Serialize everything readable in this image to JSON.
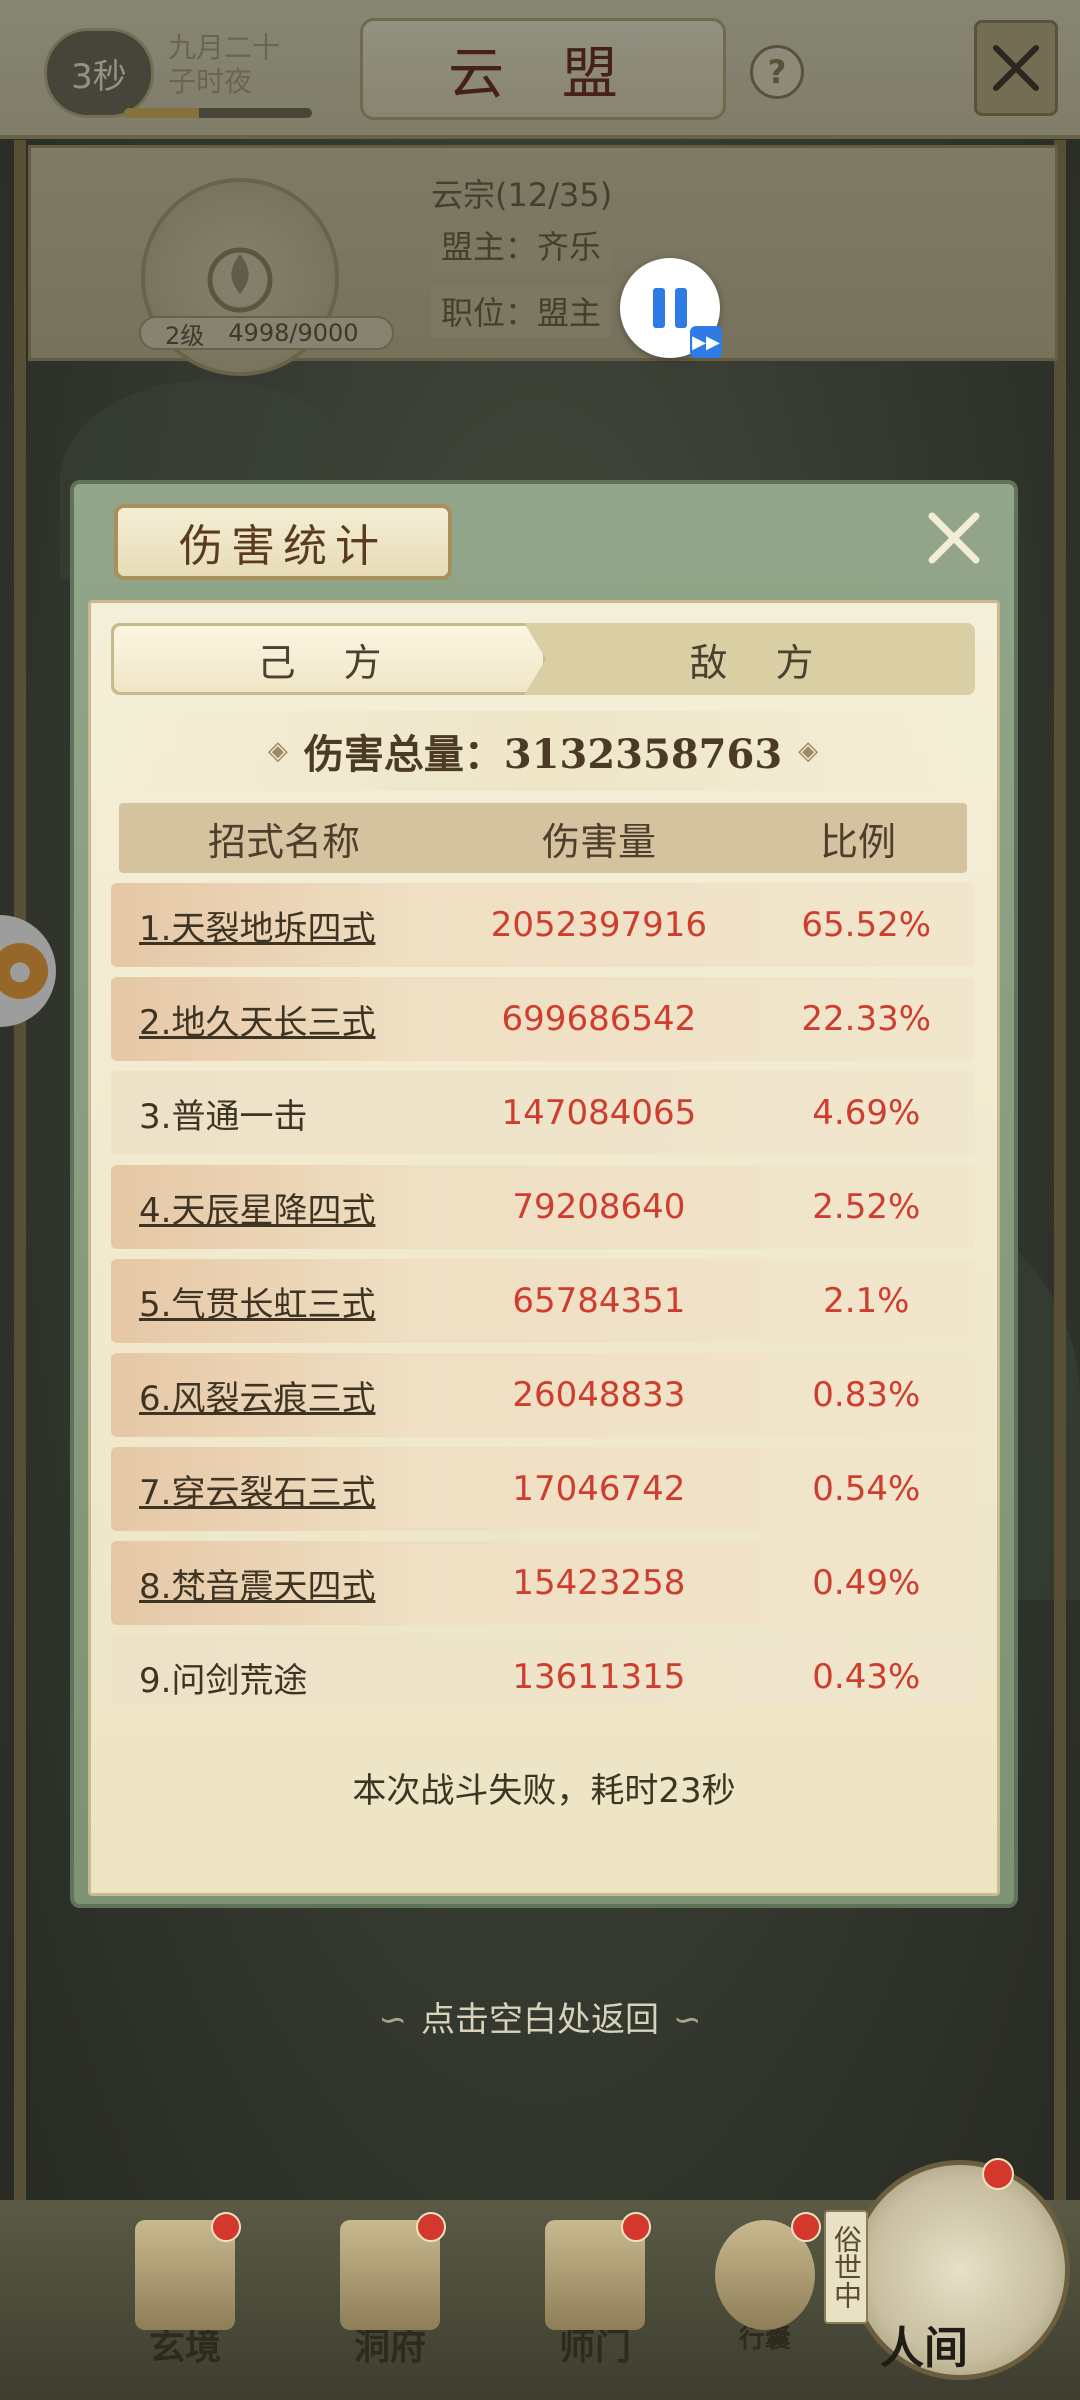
{
  "header": {
    "timer": "3秒",
    "date_line1": "九月二十",
    "date_line2": "子时夜",
    "time_progress": 0.4,
    "title": "云 盟",
    "help_label": "?"
  },
  "alliance": {
    "name_count": "云宗(12/35)",
    "leader": "盟主：齐乐",
    "position": "职位：盟主",
    "level": "2级",
    "exp": "4998/9000"
  },
  "modal": {
    "title": "伤害统计",
    "tabs": [
      "己 方",
      "敌 方"
    ],
    "active_tab": 0,
    "total_label": "伤害总量：3132358763",
    "columns": [
      "招式名称",
      "伤害量",
      "比例"
    ],
    "rows": [
      {
        "name": "1.天裂地坼四式",
        "damage": "2052397916",
        "ratio": "65.52%",
        "link": true
      },
      {
        "name": "2.地久天长三式",
        "damage": "699686542",
        "ratio": "22.33%",
        "link": true
      },
      {
        "name": "3.普通一击",
        "damage": "147084065",
        "ratio": "4.69%",
        "link": false
      },
      {
        "name": "4.天辰星降四式",
        "damage": "79208640",
        "ratio": "2.52%",
        "link": true
      },
      {
        "name": "5.气贯长虹三式",
        "damage": "65784351",
        "ratio": "2.1%",
        "link": true
      },
      {
        "name": "6.风裂云痕三式",
        "damage": "26048833",
        "ratio": "0.83%",
        "link": true
      },
      {
        "name": "7.穿云裂石三式",
        "damage": "17046742",
        "ratio": "0.54%",
        "link": true
      },
      {
        "name": "8.梵音震天四式",
        "damage": "15423258",
        "ratio": "0.49%",
        "link": true
      },
      {
        "name": "9.问剑荒途",
        "damage": "13611315",
        "ratio": "0.43%",
        "link": false
      }
    ],
    "result": "本次战斗失败，耗时23秒"
  },
  "dismiss_hint": "点击空白处返回",
  "bottom_nav": {
    "items": [
      "玄境",
      "洞府",
      "师门",
      "行囊"
    ],
    "world_label": "人间",
    "world_tag": "俗世中"
  },
  "colors": {
    "damage_red": "#cf3d2e",
    "badge_red": "#d4372b",
    "fab_blue": "#2f7be6",
    "fab_orange": "#f6a23a"
  }
}
